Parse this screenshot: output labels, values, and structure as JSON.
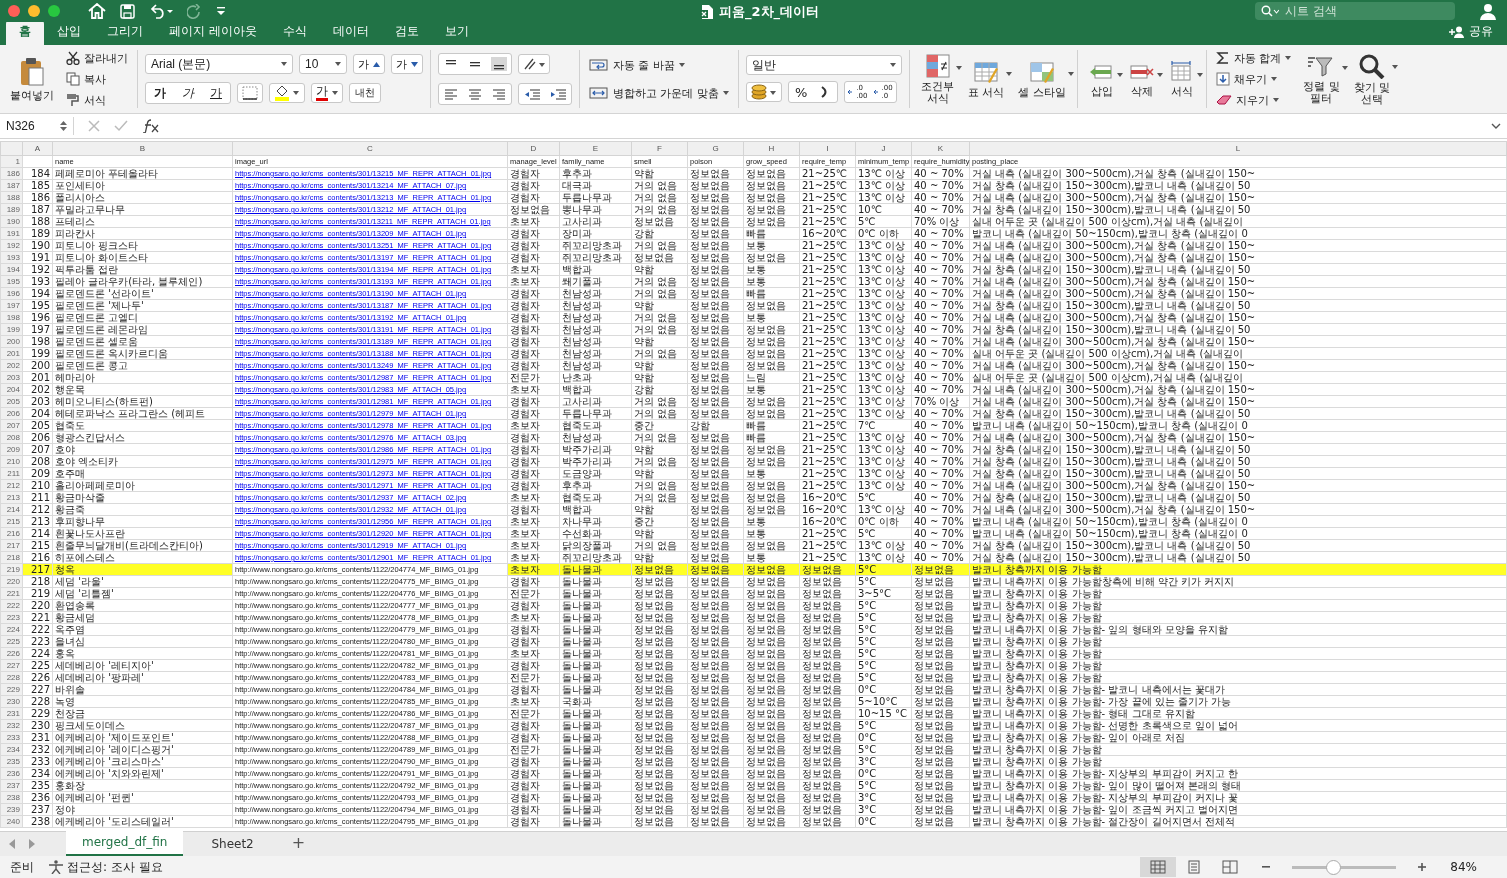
{
  "title_bar": {
    "title": "피움_2차_데이터",
    "search_placeholder": "시트 검색"
  },
  "tabs": [
    {
      "label": "홈",
      "selected": true
    },
    {
      "label": "삽입",
      "selected": false
    },
    {
      "label": "그리기",
      "selected": false
    },
    {
      "label": "페이지 레이아웃",
      "selected": false
    },
    {
      "label": "수식",
      "selected": false
    },
    {
      "label": "데이터",
      "selected": false
    },
    {
      "label": "검토",
      "selected": false
    },
    {
      "label": "보기",
      "selected": false
    }
  ],
  "share": "공유",
  "ribbon": {
    "paste": "붙여넣기",
    "cut": "잘라내기",
    "copy": "복사",
    "format_painter": "서식",
    "font": "Arial (본문)",
    "font_size": "10",
    "grow_font": "가",
    "shrink_font": "가",
    "bold": "가",
    "italic": "가",
    "underline": "가",
    "font_color": "가",
    "phonetic": "내천",
    "wrap_text": "자동 줄 바꿈",
    "merge": "병합하고 가운데 맞춤",
    "number_format": "일반",
    "percent": "%",
    "decimals": [
      {
        "top": ".0",
        "bottom": ".00"
      },
      {
        "top": ".00",
        "bottom": ".0"
      }
    ],
    "styles": [
      "조건부\n서식",
      "표 서식",
      "셀 스타일"
    ],
    "cells": [
      "삽입",
      "삭제",
      "서식"
    ],
    "autosum": "자동 합계",
    "fill": "채우기",
    "clear": "지우기",
    "sort": "정렬 및\n필터",
    "find": "찾기 및\n선택"
  },
  "formula_bar": {
    "name_box": "N326"
  },
  "columns": [
    {
      "letter": "A",
      "kind": "number"
    },
    {
      "letter": "B",
      "name": "name",
      "kind": "text"
    },
    {
      "letter": "C",
      "name": "image_url",
      "kind": "url"
    },
    {
      "letter": "D",
      "name": "manage_level",
      "kind": "text"
    },
    {
      "letter": "E",
      "name": "family_name",
      "kind": "text"
    },
    {
      "letter": "F",
      "name": "smell",
      "kind": "text"
    },
    {
      "letter": "G",
      "name": "poison",
      "kind": "text"
    },
    {
      "letter": "H",
      "name": "grow_speed",
      "kind": "text"
    },
    {
      "letter": "I",
      "name": "require_temp",
      "kind": "text"
    },
    {
      "letter": "J",
      "name": "minimum_temp",
      "kind": "text"
    },
    {
      "letter": "K",
      "name": "require_humidity",
      "kind": "text"
    },
    {
      "letter": "L",
      "name": "posting_place",
      "kind": "text"
    }
  ],
  "header_row": "1",
  "rows": [
    {
      "num": "186",
      "link": true,
      "highlighted": false,
      "cells": [
        "184",
        "페페로미아 푸테올라타",
        "https://nongsaro.go.kr/cms_contents/301/13215_MF_REPR_ATTACH_01.jpg",
        "경험자",
        "후추과",
        "약함",
        "정보없음",
        "정보없음",
        "21~25℃",
        "13℃ 이상",
        "40 ~ 70%",
        "거실 내측 (실내깊이 300~500cm),거실 창측 (실내깊이 150~"
      ]
    },
    {
      "num": "187",
      "link": true,
      "highlighted": false,
      "cells": [
        "185",
        "포인세티아",
        "https://nongsaro.go.kr/cms_contents/301/13214_MF_ATTACH_07.jpg",
        "경험자",
        "대극과",
        "거의 없음",
        "정보없음",
        "정보없음",
        "21~25℃",
        "13℃ 이상",
        "40 ~ 70%",
        "거실 창측 (실내깊이 150~300cm),발코니 내측 (실내깊이 50"
      ]
    },
    {
      "num": "188",
      "link": true,
      "highlighted": false,
      "cells": [
        "186",
        "폴리시아스",
        "https://nongsaro.go.kr/cms_contents/301/13213_MF_REPR_ATTACH_01.jpg",
        "경험자",
        "두릅나무과",
        "거의 없음",
        "정보없음",
        "정보없음",
        "21~25℃",
        "13℃ 이상",
        "40 ~ 70%",
        "거실 내측 (실내깊이 300~500cm),거실 창측 (실내깊이 150~"
      ]
    },
    {
      "num": "189",
      "link": true,
      "highlighted": false,
      "cells": [
        "187",
        "푸밀라고무나무",
        "https://nongsaro.go.kr/cms_contents/301/13212_MF_ATTACH_01.jpg",
        "정보없음",
        "뽕나무과",
        "거의 없음",
        "정보없음",
        "정보없음",
        "21~25℃",
        "10℃",
        "40 ~ 70%",
        "거실 창측 (실내깊이 150~300cm),발코니 내측 (실내깊이 50"
      ]
    },
    {
      "num": "190",
      "link": true,
      "highlighted": false,
      "cells": [
        "188",
        "프테리스",
        "https://nongsaro.go.kr/cms_contents/301/13211_MF_REPR_ATTACH_01.jpg",
        "초보자",
        "고사리과",
        "정보없음",
        "정보없음",
        "정보없음",
        "21~25℃",
        "5℃",
        "70% 이상",
        "실내 어두운 곳 (실내깊이 500 이상cm),거실 내측 (실내깊이"
      ]
    },
    {
      "num": "191",
      "link": true,
      "highlighted": false,
      "cells": [
        "189",
        "피라칸사",
        "https://nongsaro.go.kr/cms_contents/301/13209_MF_ATTACH_01.jpg",
        "경험자",
        "장미과",
        "강함",
        "정보없음",
        "빠름",
        "16~20℃",
        "0℃ 이하",
        "40 ~ 70%",
        "발코니 내측 (실내깊이 50~150cm),발코니 창측 (실내깊이 0"
      ]
    },
    {
      "num": "192",
      "link": true,
      "highlighted": false,
      "cells": [
        "190",
        "피토니아 핑크스타",
        "https://nongsaro.go.kr/cms_contents/301/13251_MF_REPR_ATTACH_01.jpg",
        "경험자",
        "쥐꼬리망초과",
        "거의 없음",
        "정보없음",
        "보통",
        "21~25℃",
        "13℃ 이상",
        "40 ~ 70%",
        "거실 내측 (실내깊이 300~500cm),거실 창측 (실내깊이 150~"
      ]
    },
    {
      "num": "193",
      "link": true,
      "highlighted": false,
      "cells": [
        "191",
        "피토니아 화이트스타",
        "https://nongsaro.go.kr/cms_contents/301/13197_MF_REPR_ATTACH_01.jpg",
        "경험자",
        "쥐꼬리망초과",
        "정보없음",
        "정보없음",
        "정보없음",
        "21~25℃",
        "13℃ 이상",
        "40 ~ 70%",
        "거실 내측 (실내깊이 300~500cm),거실 창측 (실내깊이 150~"
      ]
    },
    {
      "num": "194",
      "link": true,
      "highlighted": false,
      "cells": [
        "192",
        "픽투라툼 접란",
        "https://nongsaro.go.kr/cms_contents/301/13194_MF_REPR_ATTACH_01.jpg",
        "초보자",
        "백합과",
        "약함",
        "정보없음",
        "보통",
        "21~25℃",
        "13℃ 이상",
        "40 ~ 70%",
        "거실 창측 (실내깊이 150~300cm),발코니 내측 (실내깊이 50"
      ]
    },
    {
      "num": "195",
      "link": true,
      "highlighted": false,
      "cells": [
        "193",
        "필레아 글라우카(타라, 블루체인)",
        "https://nongsaro.go.kr/cms_contents/301/13193_MF_REPR_ATTACH_01.jpg",
        "초보자",
        "쐐기풀과",
        "거의 없음",
        "정보없음",
        "보통",
        "21~25℃",
        "13℃ 이상",
        "40 ~ 70%",
        "거실 내측 (실내깊이 300~500cm),거실 창측 (실내깊이 150~"
      ]
    },
    {
      "num": "196",
      "link": true,
      "highlighted": false,
      "cells": [
        "194",
        "필로덴드론 '선라이트'",
        "https://nongsaro.go.kr/cms_contents/301/13190_MF_ATTACH_01.jpg",
        "경험자",
        "천남성과",
        "거의 없음",
        "정보없음",
        "빠름",
        "21~25℃",
        "13℃ 이상",
        "40 ~ 70%",
        "거실 내측 (실내깊이 300~500cm),거실 창측 (실내깊이 150~"
      ]
    },
    {
      "num": "197",
      "link": true,
      "highlighted": false,
      "cells": [
        "195",
        "필로덴드론 '제나두'",
        "https://nongsaro.go.kr/cms_contents/301/13187_MF_REPR_ATTACH_01.jpg",
        "경험자",
        "천남성과",
        "약함",
        "정보없음",
        "정보없음",
        "21~25℃",
        "13℃ 이상",
        "40 ~ 70%",
        "거실 창측 (실내깊이 150~300cm),발코니 내측 (실내깊이 50"
      ]
    },
    {
      "num": "198",
      "link": true,
      "highlighted": false,
      "cells": [
        "196",
        "필로덴드론 고엘디",
        "https://nongsaro.go.kr/cms_contents/301/13192_MF_ATTACH_01.jpg",
        "경험자",
        "천남성과",
        "거의 없음",
        "정보없음",
        "보통",
        "21~25℃",
        "13℃ 이상",
        "40 ~ 70%",
        "거실 내측 (실내깊이 300~500cm),거실 창측 (실내깊이 150~"
      ]
    },
    {
      "num": "199",
      "link": true,
      "highlighted": false,
      "cells": [
        "197",
        "필로덴드론 레몬라임",
        "https://nongsaro.go.kr/cms_contents/301/13191_MF_REPR_ATTACH_01.jpg",
        "경험자",
        "천남성과",
        "거의 없음",
        "정보없음",
        "정보없음",
        "21~25℃",
        "13℃ 이상",
        "40 ~ 70%",
        "거실 창측 (실내깊이 150~300cm),발코니 내측 (실내깊이 50"
      ]
    },
    {
      "num": "200",
      "link": true,
      "highlighted": false,
      "cells": [
        "198",
        "필로덴드론 셀로움",
        "https://nongsaro.go.kr/cms_contents/301/13189_MF_REPR_ATTACH_01.jpg",
        "경험자",
        "천남성과",
        "약함",
        "정보없음",
        "정보없음",
        "21~25℃",
        "13℃ 이상",
        "40 ~ 70%",
        "거실 내측 (실내깊이 300~500cm),거실 창측 (실내깊이 150~"
      ]
    },
    {
      "num": "201",
      "link": true,
      "highlighted": false,
      "cells": [
        "199",
        "필로덴드론 옥시카르디움",
        "https://nongsaro.go.kr/cms_contents/301/13188_MF_REPR_ATTACH_01.jpg",
        "경험자",
        "천남성과",
        "거의 없음",
        "정보없음",
        "정보없음",
        "21~25℃",
        "13℃ 이상",
        "40 ~ 70%",
        "실내 어두운 곳 (실내깊이 500 이상cm),거실 내측 (실내깊이"
      ]
    },
    {
      "num": "202",
      "link": true,
      "highlighted": false,
      "cells": [
        "200",
        "필로덴드론 콩고",
        "https://nongsaro.go.kr/cms_contents/301/13249_MF_REPR_ATTACH_01.jpg",
        "경험자",
        "천남성과",
        "약함",
        "정보없음",
        "정보없음",
        "21~25℃",
        "13℃ 이상",
        "40 ~ 70%",
        "거실 내측 (실내깊이 300~500cm),거실 창측 (실내깊이 150~"
      ]
    },
    {
      "num": "203",
      "link": true,
      "highlighted": false,
      "cells": [
        "201",
        "헤마리아",
        "https://nongsaro.go.kr/cms_contents/301/12987_MF_REPR_ATTACH_01.jpg",
        "전문가",
        "난초과",
        "약함",
        "정보없음",
        "느림",
        "21~25℃",
        "13℃ 이상",
        "40 ~ 70%",
        "실내 어두운 곳 (실내깊이 500 이상cm),거실 내측 (실내깊이"
      ]
    },
    {
      "num": "204",
      "link": true,
      "highlighted": false,
      "cells": [
        "202",
        "행운목",
        "https://nongsaro.go.kr/cms_contents/301/12983_MF_ATTACH_05.jpg",
        "초보자",
        "백합과",
        "강함",
        "정보없음",
        "보통",
        "21~25℃",
        "13℃ 이상",
        "40 ~ 70%",
        "거실 내측 (실내깊이 300~500cm),거실 창측 (실내깊이 150~"
      ]
    },
    {
      "num": "205",
      "link": true,
      "highlighted": false,
      "cells": [
        "203",
        "헤미오니티스(하트펀)",
        "https://nongsaro.go.kr/cms_contents/301/12981_MF_REPR_ATTACH_01.jpg",
        "경험자",
        "고사리과",
        "거의 없음",
        "정보없음",
        "정보없음",
        "21~25℃",
        "13℃ 이상",
        "70% 이상",
        "거실 내측 (실내깊이 300~500cm),거실 창측 (실내깊이 150~"
      ]
    },
    {
      "num": "206",
      "link": true,
      "highlighted": false,
      "cells": [
        "204",
        "헤테로파낙스 프라그란스 (헤피트",
        "https://nongsaro.go.kr/cms_contents/301/12979_MF_ATTACH_01.jpg",
        "경험자",
        "두릅나무과",
        "거의 없음",
        "정보없음",
        "정보없음",
        "21~25℃",
        "13℃ 이상",
        "40 ~ 70%",
        "거실 창측 (실내깊이 150~300cm),발코니 내측 (실내깊이 50"
      ]
    },
    {
      "num": "207",
      "link": true,
      "highlighted": false,
      "cells": [
        "205",
        "협죽도",
        "https://nongsaro.go.kr/cms_contents/301/12978_MF_REPR_ATTACH_01.jpg",
        "초보자",
        "협죽도과",
        "중간",
        "강함",
        "빠름",
        "21~25℃",
        "7℃",
        "40 ~ 70%",
        "발코니 내측 (실내깊이 50~150cm),발코니 창측 (실내깊이 0"
      ]
    },
    {
      "num": "208",
      "link": true,
      "highlighted": false,
      "cells": [
        "206",
        "형광스킨답서스",
        "https://nongsaro.go.kr/cms_contents/301/12976_MF_ATTACH_03.jpg",
        "경험자",
        "천남성과",
        "거의 없음",
        "정보없음",
        "빠름",
        "21~25℃",
        "13℃ 이상",
        "40 ~ 70%",
        "거실 내측 (실내깊이 300~500cm),거실 창측 (실내깊이 150~"
      ]
    },
    {
      "num": "209",
      "link": true,
      "highlighted": false,
      "cells": [
        "207",
        "호야",
        "https://nongsaro.go.kr/cms_contents/301/12986_MF_REPR_ATTACH_01.jpg",
        "경험자",
        "박주가리과",
        "약함",
        "정보없음",
        "정보없음",
        "21~25℃",
        "13℃ 이상",
        "40 ~ 70%",
        "거실 창측 (실내깊이 150~300cm),발코니 내측 (실내깊이 50"
      ]
    },
    {
      "num": "210",
      "link": true,
      "highlighted": false,
      "cells": [
        "208",
        "호야 엑소티카",
        "https://nongsaro.go.kr/cms_contents/301/12975_MF_REPR_ATTACH_01.jpg",
        "경험자",
        "박주가리과",
        "거의 없음",
        "정보없음",
        "정보없음",
        "21~25℃",
        "13℃ 이상",
        "40 ~ 70%",
        "거실 창측 (실내깊이 150~300cm),발코니 내측 (실내깊이 50"
      ]
    },
    {
      "num": "211",
      "link": true,
      "highlighted": false,
      "cells": [
        "209",
        "호주매",
        "https://nongsaro.go.kr/cms_contents/301/12973_MF_REPR_ATTACH_01.jpg",
        "경험자",
        "도금양과",
        "약함",
        "정보없음",
        "보통",
        "21~25℃",
        "13℃ 이상",
        "40 ~ 70%",
        "거실 창측 (실내깊이 150~300cm),발코니 내측 (실내깊이 50"
      ]
    },
    {
      "num": "212",
      "link": true,
      "highlighted": false,
      "cells": [
        "210",
        "홀리아페페로미아",
        "https://nongsaro.go.kr/cms_contents/301/12971_MF_REPR_ATTACH_01.jpg",
        "경험자",
        "후추과",
        "거의 없음",
        "정보없음",
        "정보없음",
        "21~25℃",
        "13℃ 이상",
        "40 ~ 70%",
        "거실 내측 (실내깊이 300~500cm),거실 창측 (실내깊이 150~"
      ]
    },
    {
      "num": "213",
      "link": true,
      "highlighted": false,
      "cells": [
        "211",
        "황금마삭줄",
        "https://nongsaro.go.kr/cms_contents/301/12937_MF_ATTACH_02.jpg",
        "초보자",
        "협죽도과",
        "거의 없음",
        "정보없음",
        "정보없음",
        "16~20℃",
        "5℃",
        "40 ~ 70%",
        "거실 창측 (실내깊이 150~300cm),발코니 내측 (실내깊이 50"
      ]
    },
    {
      "num": "214",
      "link": true,
      "highlighted": false,
      "cells": [
        "212",
        "황금죽",
        "https://nongsaro.go.kr/cms_contents/301/12932_MF_ATTACH_01.jpg",
        "경험자",
        "백합과",
        "약함",
        "정보없음",
        "정보없음",
        "16~20℃",
        "13℃ 이상",
        "40 ~ 70%",
        "거실 내측 (실내깊이 300~500cm),거실 창측 (실내깊이 150~"
      ]
    },
    {
      "num": "215",
      "link": true,
      "highlighted": false,
      "cells": [
        "213",
        "후피향나무",
        "https://nongsaro.go.kr/cms_contents/301/12956_MF_REPR_ATTACH_01.jpg",
        "초보자",
        "차나무과",
        "중간",
        "정보없음",
        "보통",
        "16~20℃",
        "0℃ 이하",
        "40 ~ 70%",
        "발코니 내측 (실내깊이 50~150cm),발코니 창측 (실내깊이 0"
      ]
    },
    {
      "num": "216",
      "link": true,
      "highlighted": false,
      "cells": [
        "214",
        "흰꽃나도사프란",
        "https://nongsaro.go.kr/cms_contents/301/12920_MF_REPR_ATTACH_01.jpg",
        "초보자",
        "수선화과",
        "약함",
        "정보없음",
        "보통",
        "21~25℃",
        "5℃",
        "40 ~ 70%",
        "발코니 내측 (실내깊이 50~150cm),발코니 창측 (실내깊이 0"
      ]
    },
    {
      "num": "217",
      "link": true,
      "highlighted": false,
      "cells": [
        "215",
        "흰줄무늬달개비(트라데스칸티아)",
        "https://nongsaro.go.kr/cms_contents/301/12919_MF_ATTACH_01.jpg",
        "초보자",
        "닭의장풀과",
        "거의 없음",
        "정보없음",
        "정보없음",
        "21~25℃",
        "13℃ 이상",
        "40 ~ 70%",
        "거실 창측 (실내깊이 150~300cm),발코니 내측 (실내깊이 50"
      ]
    },
    {
      "num": "218",
      "link": true,
      "highlighted": false,
      "cells": [
        "216",
        "히포에스테스",
        "https://nongsaro.go.kr/cms_contents/301/12901_MF_REPR_ATTACH_01.jpg",
        "초보자",
        "쥐꼬리망초과",
        "약함",
        "정보없음",
        "보통",
        "21~25℃",
        "13℃ 이상",
        "40 ~ 70%",
        "거실 창측 (실내깊이 150~300cm),발코니 내측 (실내깊이 50"
      ]
    },
    {
      "num": "219",
      "link": false,
      "highlighted": true,
      "cells": [
        "217",
        "청옥",
        "http://www.nongsaro.go.kr/cms_contents/1122/204774_MF_BIMG_01.jpg",
        "초보자",
        "돌나물과",
        "정보없음",
        "정보없음",
        "정보없음",
        "정보없음",
        "5°C",
        "정보없음",
        "발코니 창측까지 이용 가능함"
      ]
    },
    {
      "num": "220",
      "link": false,
      "highlighted": false,
      "cells": [
        "218",
        "세덤 '라울'",
        "http://www.nongsaro.go.kr/cms_contents/1122/204775_MF_BIMG_01.jpg",
        "경험자",
        "돌나물과",
        "정보없음",
        "정보없음",
        "정보없음",
        "정보없음",
        "5°C",
        "정보없음",
        "발코니 내측까지 이용 가능함창측에 비해 약간 키가 커지지"
      ]
    },
    {
      "num": "221",
      "link": false,
      "highlighted": false,
      "cells": [
        "219",
        "세덤 '리틀젬'",
        "http://www.nongsaro.go.kr/cms_contents/1122/204776_MF_BIMG_01.jpg",
        "전문가",
        "돌나물과",
        "정보없음",
        "정보없음",
        "정보없음",
        "정보없음",
        "3~5°C",
        "정보없음",
        "발코니 창측까지 이용 가능함"
      ]
    },
    {
      "num": "222",
      "link": false,
      "highlighted": false,
      "cells": [
        "220",
        "환엽송록",
        "http://www.nongsaro.go.kr/cms_contents/1122/204777_MF_BIMG_01.jpg",
        "경험자",
        "돌나물과",
        "정보없음",
        "정보없음",
        "정보없음",
        "정보없음",
        "5°C",
        "정보없음",
        "발코니 창측까지 이용 가능함"
      ]
    },
    {
      "num": "223",
      "link": false,
      "highlighted": false,
      "cells": [
        "221",
        "황금세덤",
        "http://www.nongsaro.go.kr/cms_contents/1122/204778_MF_BIMG_01.jpg",
        "초보자",
        "돌나물과",
        "정보없음",
        "정보없음",
        "정보없음",
        "정보없음",
        "5°C",
        "정보없음",
        "발코니 창측까지 이용 가능함"
      ]
    },
    {
      "num": "224",
      "link": false,
      "highlighted": false,
      "cells": [
        "222",
        "옥주염",
        "http://www.nongsaro.go.kr/cms_contents/1122/204779_MF_BIMG_01.jpg",
        "경험자",
        "돌나물과",
        "정보없음",
        "정보없음",
        "정보없음",
        "정보없음",
        "5°C",
        "정보없음",
        "발코니 내측까지 이용 가능함- 잎의 형태와 모양을 유지함"
      ]
    },
    {
      "num": "225",
      "link": false,
      "highlighted": false,
      "cells": [
        "223",
        "을녀심",
        "http://www.nongsaro.go.kr/cms_contents/1122/204780_MF_BIMG_01.jpg",
        "경험자",
        "돌나물과",
        "정보없음",
        "정보없음",
        "정보없음",
        "정보없음",
        "5°C",
        "정보없음",
        "발코니 창측까지 이용 가능함"
      ]
    },
    {
      "num": "226",
      "link": false,
      "highlighted": false,
      "cells": [
        "224",
        "홍옥",
        "http://www.nongsaro.go.kr/cms_contents/1122/204781_MF_BIMG_01.jpg",
        "초보자",
        "돌나물과",
        "정보없음",
        "정보없음",
        "정보없음",
        "정보없음",
        "5°C",
        "정보없음",
        "발코니 창측까지 이용 가능함"
      ]
    },
    {
      "num": "227",
      "link": false,
      "highlighted": false,
      "cells": [
        "225",
        "세데베리아 '레티지아'",
        "http://www.nongsaro.go.kr/cms_contents/1122/204782_MF_BIMG_01.jpg",
        "경험자",
        "돌나물과",
        "정보없음",
        "정보없음",
        "정보없음",
        "정보없음",
        "5°C",
        "정보없음",
        "발코니 창측까지 이용 가능함"
      ]
    },
    {
      "num": "228",
      "link": false,
      "highlighted": false,
      "cells": [
        "226",
        "세데베리아 '팡파레'",
        "http://www.nongsaro.go.kr/cms_contents/1122/204783_MF_BIMG_01.jpg",
        "전문가",
        "돌나물과",
        "정보없음",
        "정보없음",
        "정보없음",
        "정보없음",
        "5°C",
        "정보없음",
        "발코니 창측까지 이용 가능함"
      ]
    },
    {
      "num": "229",
      "link": false,
      "highlighted": false,
      "cells": [
        "227",
        "바위솔",
        "http://www.nongsaro.go.kr/cms_contents/1122/204784_MF_BIMG_01.jpg",
        "경험자",
        "돌나물과",
        "정보없음",
        "정보없음",
        "정보없음",
        "정보없음",
        "0°C",
        "정보없음",
        "발코니 창측까지 이용 가능함- 발코니 내측에서는 꽃대가"
      ]
    },
    {
      "num": "230",
      "link": false,
      "highlighted": false,
      "cells": [
        "228",
        "녹영",
        "http://www.nongsaro.go.kr/cms_contents/1122/204785_MF_BIMG_01.jpg",
        "초보자",
        "국화과",
        "정보없음",
        "정보없음",
        "정보없음",
        "정보없음",
        "5~10°C",
        "정보없음",
        "발코니 창측까지 이용 가능함- 가장 끝에 있는 줄기가 가능"
      ]
    },
    {
      "num": "231",
      "link": false,
      "highlighted": false,
      "cells": [
        "229",
        "천장금",
        "http://www.nongsaro.go.kr/cms_contents/1122/204786_MF_BIMG_01.jpg",
        "전문가",
        "돌나물과",
        "정보없음",
        "정보없음",
        "정보없음",
        "정보없음",
        "10~15 °C",
        "정보없음",
        "발코니 내측까지 이용 가능함- 형태 그대로 유지함"
      ]
    },
    {
      "num": "232",
      "link": false,
      "highlighted": false,
      "cells": [
        "230",
        "핑크세도이데스",
        "http://www.nongsaro.go.kr/cms_contents/1122/204787_MF_BIMG_01.jpg",
        "경험자",
        "돌나물과",
        "정보없음",
        "정보없음",
        "정보없음",
        "정보없음",
        "5°C",
        "정보없음",
        "발코니 내측까지 이용 가능함- 선명한 초록색으로 잎이 넓어"
      ]
    },
    {
      "num": "233",
      "link": false,
      "highlighted": false,
      "cells": [
        "231",
        "에케베리아 '제이드포인트'",
        "http://www.nongsaro.go.kr/cms_contents/1122/204788_MF_BIMG_01.jpg",
        "경험자",
        "돌나물과",
        "정보없음",
        "정보없음",
        "정보없음",
        "정보없음",
        "0°C",
        "정보없음",
        "발코니 창측까지 이용 가능함- 잎이 아래로 처짐"
      ]
    },
    {
      "num": "234",
      "link": false,
      "highlighted": false,
      "cells": [
        "232",
        "에케베리아 '레이디스핑거'",
        "http://www.nongsaro.go.kr/cms_contents/1122/204789_MF_BIMG_01.jpg",
        "전문가",
        "돌나물과",
        "정보없음",
        "정보없음",
        "정보없음",
        "정보없음",
        "5°C",
        "정보없음",
        "발코니 창측까지 이용 가능함"
      ]
    },
    {
      "num": "235",
      "link": false,
      "highlighted": false,
      "cells": [
        "233",
        "에케베리아 '크리스마스'",
        "http://www.nongsaro.go.kr/cms_contents/1122/204790_MF_BIMG_01.jpg",
        "경험자",
        "돌나물과",
        "정보없음",
        "정보없음",
        "정보없음",
        "정보없음",
        "3°C",
        "정보없음",
        "발코니 창측까지 이용 가능함"
      ]
    },
    {
      "num": "236",
      "link": false,
      "highlighted": false,
      "cells": [
        "234",
        "에케베리아 '치와와린제'",
        "http://www.nongsaro.go.kr/cms_contents/1122/204791_MF_BIMG_01.jpg",
        "경험자",
        "돌나물과",
        "정보없음",
        "정보없음",
        "정보없음",
        "정보없음",
        "0°C",
        "정보없음",
        "발코니 내측까지 이용 가능함- 지상부의 부피감이 커지고 한"
      ]
    },
    {
      "num": "237",
      "link": false,
      "highlighted": false,
      "cells": [
        "235",
        "홍화장",
        "http://www.nongsaro.go.kr/cms_contents/1122/204792_MF_BIMG_01.jpg",
        "경험자",
        "돌나물과",
        "정보없음",
        "정보없음",
        "정보없음",
        "정보없음",
        "5°C",
        "정보없음",
        "발코니 창측까지 이용 가능함- 잎이 많이 떨어져 본래의 형태"
      ]
    },
    {
      "num": "238",
      "link": false,
      "highlighted": false,
      "cells": [
        "236",
        "에케베리아 '펀퀸'",
        "http://www.nongsaro.go.kr/cms_contents/1122/204793_MF_BIMG_01.jpg",
        "경험자",
        "돌나물과",
        "정보없음",
        "정보없음",
        "정보없음",
        "정보없음",
        "3°C",
        "정보없음",
        "발코니 내측까지 이용 가능함- 지상부의 부피감이 커지나 꽃"
      ]
    },
    {
      "num": "239",
      "link": false,
      "highlighted": false,
      "cells": [
        "237",
        "정야",
        "http://www.nongsaro.go.kr/cms_contents/1122/204794_MF_BIMG_01.jpg",
        "경험자",
        "돌나물과",
        "정보없음",
        "정보없음",
        "정보없음",
        "정보없음",
        "3°C",
        "정보없음",
        "발코니 내측까지 이용 가능함- 잎이 조금씩 커지고 벌어지면"
      ]
    },
    {
      "num": "240",
      "link": false,
      "highlighted": false,
      "cells": [
        "238",
        "에케베리아 '도리스테일러'",
        "http://www.nongsaro.go.kr/cms_contents/1122/204795_MF_BIMG_01.jpg",
        "경험자",
        "돌나물과",
        "정보없음",
        "정보없음",
        "정보없음",
        "정보없음",
        "0°C",
        "정보없음",
        "발코니 창측까지 이용 가능함- 절간장이 길어지면서 전체적"
      ]
    }
  ],
  "sheets": [
    {
      "label": "merged_df_fin",
      "selected": true
    },
    {
      "label": "Sheet2",
      "selected": false
    }
  ],
  "add_sheet": "+",
  "status_bar": {
    "status": "준비",
    "accessibility": "접근성: 조사 필요",
    "views": [
      {
        "kind": "normal",
        "selected": true
      },
      {
        "kind": "page_layout",
        "selected": false
      },
      {
        "kind": "page_break",
        "selected": false
      }
    ],
    "zoom_slider": {
      "level": 0.4
    },
    "zoom": "84%"
  }
}
